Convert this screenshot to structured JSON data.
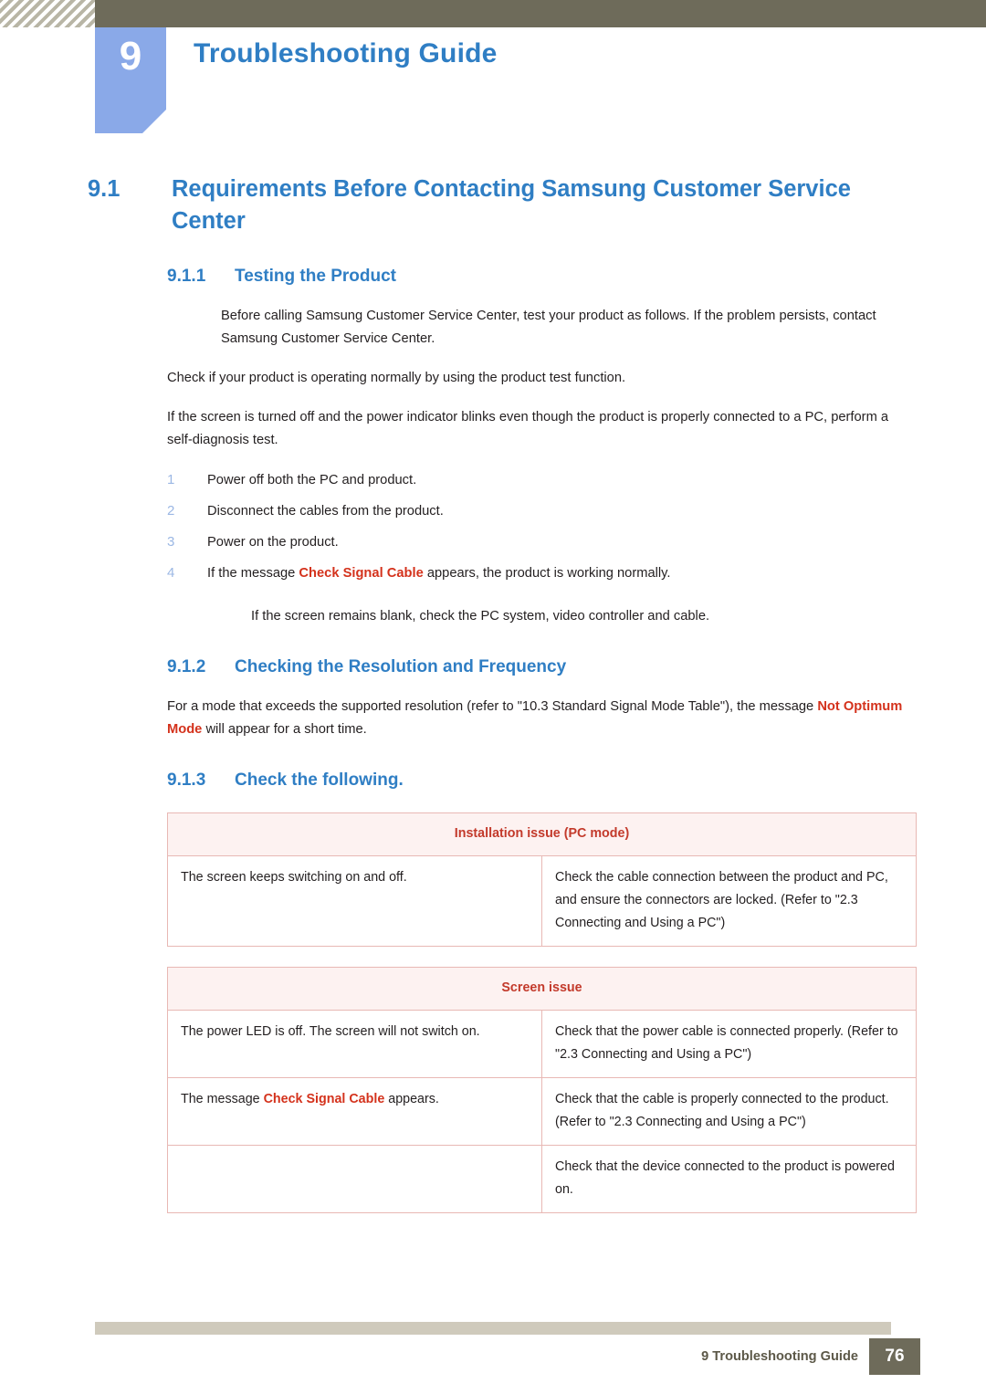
{
  "header": {
    "chapter_number": "9",
    "chapter_title": "Troubleshooting Guide"
  },
  "sections": {
    "h1": {
      "number": "9.1",
      "title": "Requirements Before Contacting Samsung Customer Service Center"
    },
    "h2_1": {
      "number": "9.1.1",
      "title": "Testing the Product"
    },
    "h2_2": {
      "number": "9.1.2",
      "title": "Checking the Resolution and Frequency"
    },
    "h2_3": {
      "number": "9.1.3",
      "title": "Check the following."
    }
  },
  "body": {
    "p1": "Before calling Samsung Customer Service Center, test your product as follows. If the problem persists, contact Samsung Customer Service Center.",
    "p2": "Check if your product is operating normally by using the product test function.",
    "p3": "If the screen is turned off and the power indicator blinks even though the product is properly connected to a PC, perform a self-diagnosis test.",
    "steps": [
      {
        "num": "1",
        "text": "Power off both the PC and product."
      },
      {
        "num": "2",
        "text": "Disconnect the cables from the product."
      },
      {
        "num": "3",
        "text": "Power on the product."
      },
      {
        "num": "4",
        "text_before": "If the message ",
        "highlight": "Check Signal Cable",
        "text_after": " appears, the product is working normally."
      }
    ],
    "p4": "If the screen remains blank, check the PC system, video controller and cable.",
    "p5_before": "For a mode that exceeds the supported resolution (refer to \"10.3 Standard Signal Mode Table\"), the message ",
    "p5_highlight": "Not Optimum Mode",
    "p5_after": " will appear for a short time."
  },
  "tables": [
    {
      "caption": "Installation issue (PC mode)",
      "rows": [
        {
          "left": "The screen keeps switching on and off.",
          "right": "Check the cable connection between the product and PC, and ensure the connectors are locked. (Refer to \"2.3 Connecting and Using a PC\")"
        }
      ]
    },
    {
      "caption": "Screen issue",
      "rows": [
        {
          "left": "The power LED is off. The screen will not switch on.",
          "right": "Check that the power cable is connected properly. (Refer to \"2.3 Connecting and Using a PC\")"
        },
        {
          "left_before": "The message ",
          "left_highlight": "Check Signal Cable",
          "left_after": " appears.",
          "right": "Check that the cable is properly connected to the product. (Refer to \"2.3 Connecting and Using a PC\")"
        },
        {
          "left": "",
          "right": "Check that the device connected to the product is powered on."
        }
      ]
    }
  ],
  "footer": {
    "label": "9 Troubleshooting Guide",
    "page_number": "76"
  },
  "colors": {
    "heading_blue": "#2f7ec4",
    "badge_blue": "#8aa9e8",
    "header_band": "#6e6b5a",
    "accent_red": "#d4321c",
    "table_border": "#e8b8b4",
    "table_caption_bg": "#fdf2f1"
  }
}
